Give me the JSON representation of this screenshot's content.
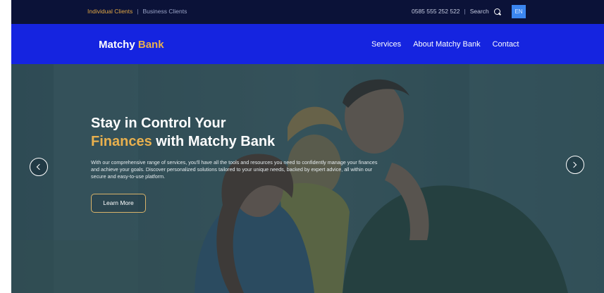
{
  "topbar": {
    "individual_clients": "Individual Clients",
    "separator": "|",
    "business_clients": "Business Clients",
    "phone": "0585 555 252 522",
    "search_label": "Search",
    "language": "EN"
  },
  "navbar": {
    "logo_main": "Matchy",
    "logo_accent": "Bank",
    "links": [
      "Services",
      "About Matchy Bank",
      "Contact"
    ]
  },
  "hero": {
    "headline_line1": "Stay in Control Your",
    "headline_accent": "Finances",
    "headline_rest": "with Matchy Bank",
    "description": "With our comprehensive range of services, you'll have all the tools and resources you need to confidently manage your finances and achieve your goals. Discover personalized solutions tailored to your unique needs, backed by expert advice, all within our secure and easy-to-use platform.",
    "cta_label": "Learn More"
  },
  "icons": {
    "search": "search-icon",
    "prev": "chevron-left-icon",
    "next": "chevron-right-icon"
  },
  "colors": {
    "topbar_bg": "#0b1238",
    "navbar_bg": "#1524e0",
    "accent": "#e8b04e",
    "lang_badge": "#3b86f0"
  }
}
